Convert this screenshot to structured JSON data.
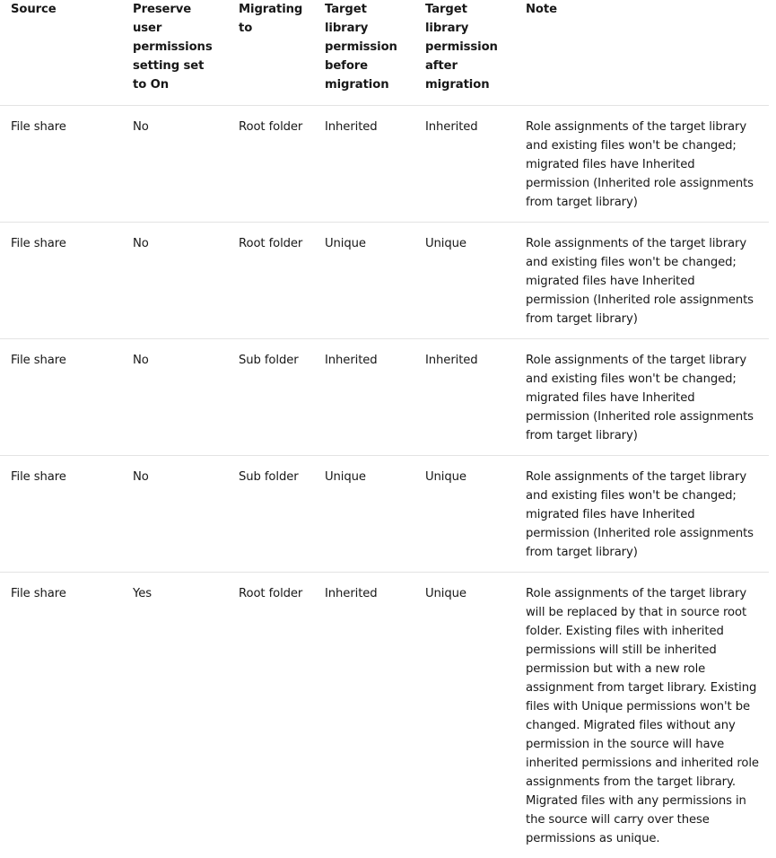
{
  "table": {
    "headers": [
      "Source",
      "Preserve user permissions setting set to On",
      "Migrating to",
      "Target library permission before migration",
      "Target library permission after migration",
      "Note"
    ],
    "rows": [
      {
        "source": "File share",
        "preserve": "No",
        "migrating_to": "Root folder",
        "before": "Inherited",
        "after": "Inherited",
        "note": "Role assignments of the target library and existing files won't be changed; migrated files have Inherited permission (Inherited role assignments from target library)"
      },
      {
        "source": "File share",
        "preserve": "No",
        "migrating_to": "Root folder",
        "before": "Unique",
        "after": "Unique",
        "note": "Role assignments of the target library and existing files won't be changed; migrated files have Inherited permission (Inherited role assignments from target library)"
      },
      {
        "source": "File share",
        "preserve": "No",
        "migrating_to": "Sub folder",
        "before": "Inherited",
        "after": "Inherited",
        "note": "Role assignments of the target library and existing files won't be changed; migrated files have Inherited permission (Inherited role assignments from target library)"
      },
      {
        "source": "File share",
        "preserve": "No",
        "migrating_to": "Sub folder",
        "before": "Unique",
        "after": "Unique",
        "note": "Role assignments of the target library and existing files won't be changed; migrated files have Inherited permission (Inherited role assignments from target library)"
      },
      {
        "source": "File share",
        "preserve": "Yes",
        "migrating_to": "Root folder",
        "before": "Inherited",
        "after": "Unique",
        "note": "Role assignments of the target library will be replaced by that in source root folder. Existing files with inherited permissions will still be inherited permission but with a new role assignment from target library. Existing files with Unique permissions won't be changed. Migrated files without any permission in the source will have inherited permissions and inherited role assignments from the target library. Migrated files with any permissions in the source will carry over these permissions as unique."
      }
    ]
  }
}
